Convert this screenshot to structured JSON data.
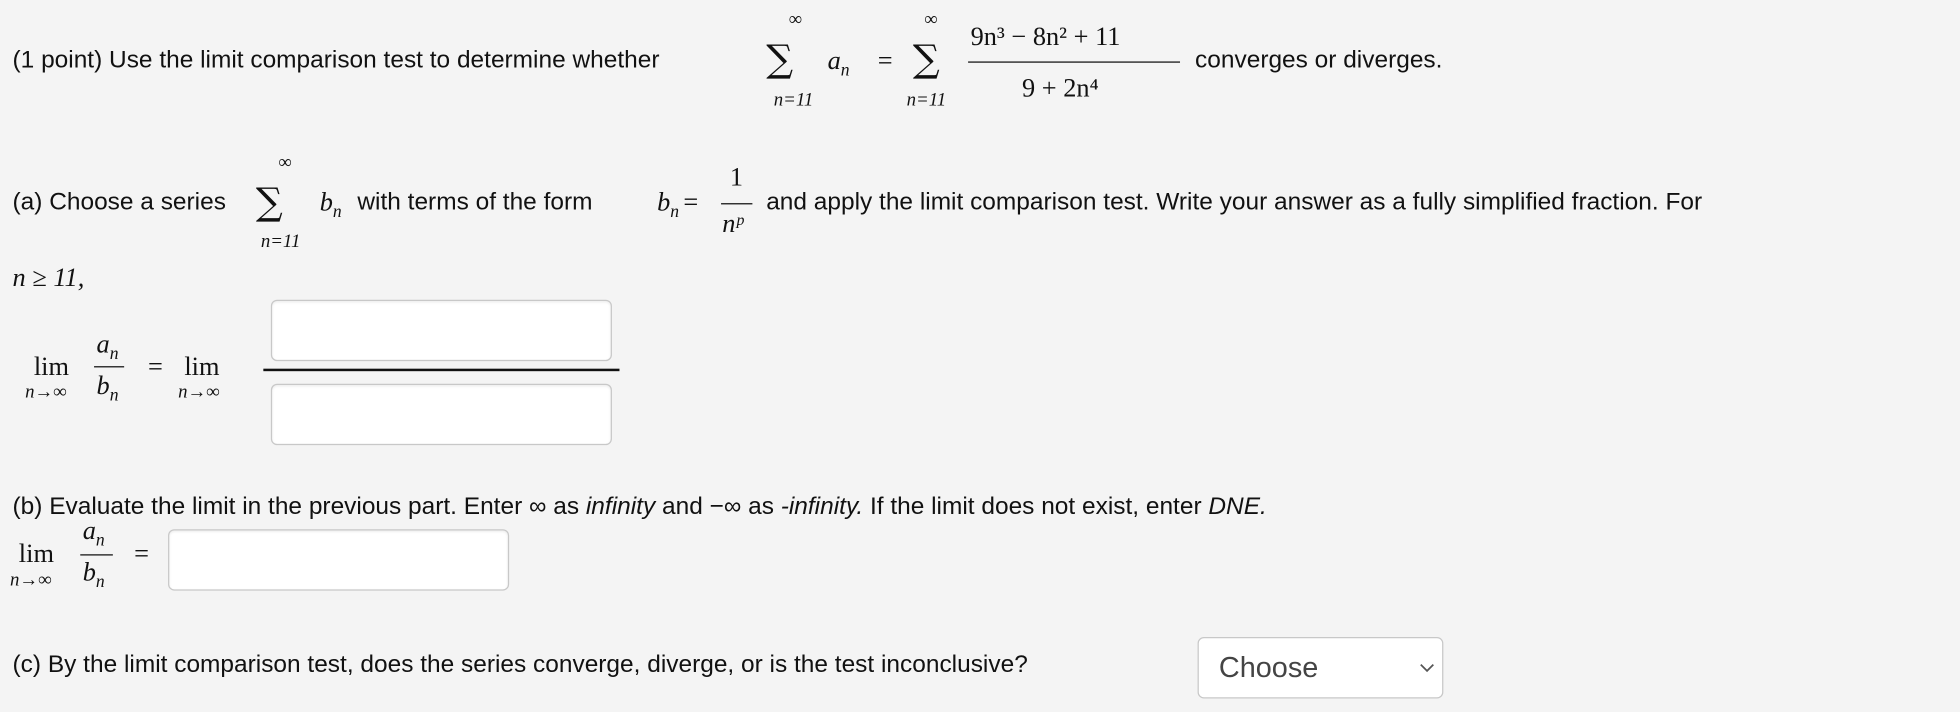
{
  "intro": {
    "prefix": "(1 point) Use the limit comparison test to determine whether",
    "suffix": "converges or diverges.",
    "sum_upper": "∞",
    "sum_lower": "n=11",
    "a_n": "a",
    "sub_n": "n",
    "equals": "=",
    "numerator": "9n³ − 8n² + 11",
    "denominator": "9 + 2n⁴"
  },
  "part_a": {
    "prefix": "(a) Choose a series",
    "middle": "with terms of the form",
    "suffix": "and apply the limit comparison test. Write your answer as a fully simplified fraction. For",
    "b": "b",
    "frac_num": "1",
    "frac_den": "nᵖ",
    "condition": "n ≥ 11,",
    "lim": "lim",
    "lim_sub": "n→∞",
    "numerator_input": "",
    "denominator_input": ""
  },
  "part_b": {
    "text1": "(b) Evaluate the limit in the previous part. Enter ∞ as ",
    "em1": "infinity",
    "text2": " and −∞ as ",
    "em2": "-infinity.",
    "text3": " If the limit does not exist, enter ",
    "em3": "DNE.",
    "answer_input": ""
  },
  "part_c": {
    "question": "(c) By the limit comparison test, does the series converge, diverge, or is the test inconclusive?",
    "select_value": "Choose",
    "chevron": "chevron-down-icon"
  }
}
